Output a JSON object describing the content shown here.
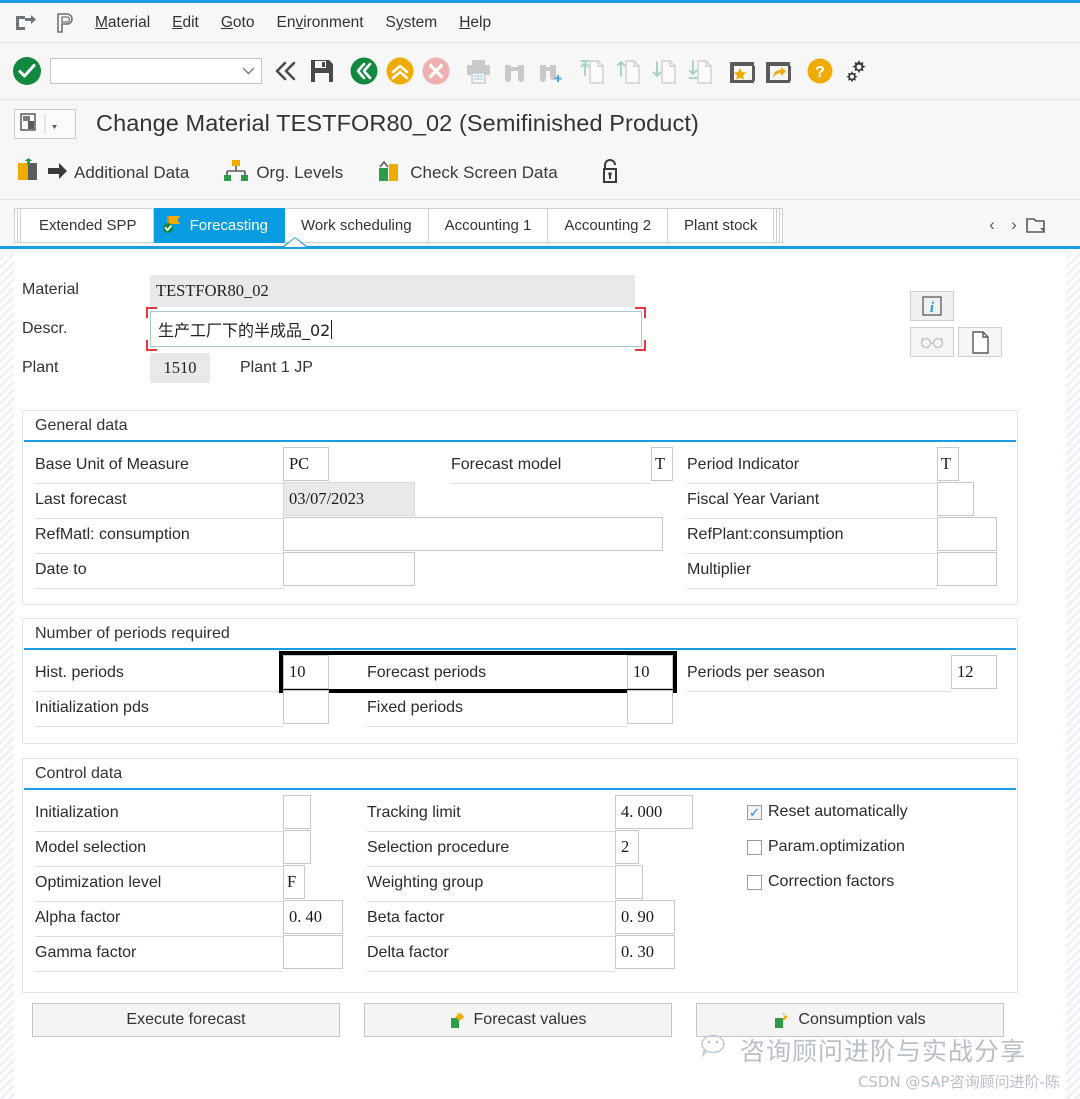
{
  "menu": {
    "icons": [
      "exit-icon",
      "sap-logo-icon"
    ],
    "items": [
      {
        "label": "Material",
        "accel": "M"
      },
      {
        "label": "Edit",
        "accel": "E"
      },
      {
        "label": "Goto",
        "accel": "G"
      },
      {
        "label": "Environment",
        "accel": "v"
      },
      {
        "label": "System",
        "accel": "y"
      },
      {
        "label": "Help",
        "accel": "H"
      }
    ]
  },
  "toolbar": {
    "command_field_value": "",
    "buttons": [
      "enter-check-icon",
      "command-dropdown-icon",
      "back-double-icon",
      "save-icon",
      "back-icon",
      "exit-up-icon",
      "cancel-icon",
      "print-icon",
      "find-icon",
      "find-next-icon",
      "first-page-icon",
      "previous-page-icon",
      "next-page-icon",
      "last-page-icon",
      "create-favorite-icon",
      "create-shortcut-icon",
      "help-icon",
      "customize-icon"
    ]
  },
  "title": {
    "icon": "screen-variant-icon",
    "text": "Change Material TESTFOR80_02 (Semifinished Product)"
  },
  "actions": [
    {
      "name": "additional-data",
      "label": "Additional Data",
      "icon": "additional-data-icon"
    },
    {
      "name": "org-levels",
      "label": "Org. Levels",
      "icon": "org-levels-icon"
    },
    {
      "name": "check-screen-data",
      "label": "Check Screen Data",
      "icon": "check-screen-data-icon"
    },
    {
      "name": "lock",
      "label": "",
      "icon": "unlock-icon"
    }
  ],
  "tabs": {
    "items": [
      {
        "label": "Extended SPP",
        "selected": false
      },
      {
        "label": "Forecasting",
        "selected": true,
        "icon": "forecasting-tab-icon"
      },
      {
        "label": "Work scheduling",
        "selected": false
      },
      {
        "label": "Accounting 1",
        "selected": false
      },
      {
        "label": "Accounting 2",
        "selected": false
      },
      {
        "label": "Plant stock",
        "selected": false
      }
    ],
    "prev_label": "‹",
    "next_label": "›",
    "list_icon": "tab-list-icon"
  },
  "header": {
    "material": {
      "label": "Material",
      "value": "TESTFOR80_02"
    },
    "descr": {
      "label": "Descr.",
      "value": "生产工厂下的半成品_02",
      "focused": true
    },
    "plant": {
      "label": "Plant",
      "value": "1510",
      "description": "Plant 1 JP"
    },
    "side_buttons": [
      {
        "name": "info-button",
        "icon": "info-i-icon"
      },
      {
        "name": "display-button",
        "icon": "glasses-icon",
        "disabled": true
      },
      {
        "name": "long-text-button",
        "icon": "document-page-icon"
      }
    ]
  },
  "general_data": {
    "title": "General data",
    "fields": [
      {
        "label": "Base Unit of Measure",
        "value": "PC",
        "readonly": false
      },
      {
        "label": "Forecast model",
        "value": "T",
        "readonly": false
      },
      {
        "label": "Period Indicator",
        "value": "T",
        "readonly": false
      },
      {
        "label": "Last forecast",
        "value": "03/07/2023",
        "readonly": true
      },
      {
        "label": "Fiscal Year Variant",
        "value": "",
        "readonly": false
      },
      {
        "label": "RefMatl: consumption",
        "value": "",
        "readonly": false
      },
      {
        "label": "RefPlant:consumption",
        "value": "",
        "readonly": false
      },
      {
        "label": "Date to",
        "value": "",
        "readonly": false
      },
      {
        "label": "Multiplier",
        "value": "",
        "readonly": false
      }
    ]
  },
  "periods": {
    "title": "Number of periods required",
    "fields": [
      {
        "label": "Hist. periods",
        "value": "10"
      },
      {
        "label": "Forecast periods",
        "value": "10"
      },
      {
        "label": "Periods per season",
        "value": "12"
      },
      {
        "label": "Initialization pds",
        "value": ""
      },
      {
        "label": "Fixed periods",
        "value": ""
      }
    ]
  },
  "control_data": {
    "title": "Control data",
    "fields": [
      {
        "label": "Initialization",
        "value": ""
      },
      {
        "label": "Tracking limit",
        "value": "4. 000"
      },
      {
        "label": "Model selection",
        "value": ""
      },
      {
        "label": "Selection procedure",
        "value": "2"
      },
      {
        "label": "Optimization level",
        "value": "F"
      },
      {
        "label": "Weighting group",
        "value": ""
      },
      {
        "label": "Alpha factor",
        "value": "0. 40"
      },
      {
        "label": "Beta factor",
        "value": "0. 90"
      },
      {
        "label": "Gamma factor",
        "value": ""
      },
      {
        "label": "Delta factor",
        "value": "0. 30"
      }
    ],
    "checkboxes": [
      {
        "label": "Reset automatically",
        "checked": true,
        "mark": "✓"
      },
      {
        "label": "Param.optimization",
        "checked": false,
        "mark": ""
      },
      {
        "label": "Correction factors",
        "checked": false,
        "mark": ""
      }
    ]
  },
  "footer_buttons": [
    {
      "name": "execute-forecast-button",
      "label": "Execute forecast",
      "icon": ""
    },
    {
      "name": "forecast-values-button",
      "label": "Forecast values",
      "icon": "navigate-green-icon"
    },
    {
      "name": "consumption-vals-button",
      "label": "Consumption vals",
      "icon": "navigate-green-icon"
    }
  ],
  "watermark": {
    "icon": "wechat-icon",
    "line1": "咨询顾问进阶与实战分享",
    "line2": "CSDN @SAP咨询顾问进阶-陈"
  },
  "colors": {
    "accent": "#1b9ce3",
    "tab_selected": "#0a9ce0",
    "focus_corner": "#e2393f",
    "green": "#2d9c4a",
    "orange": "#f0ab00",
    "red": "#e8a0a0"
  }
}
